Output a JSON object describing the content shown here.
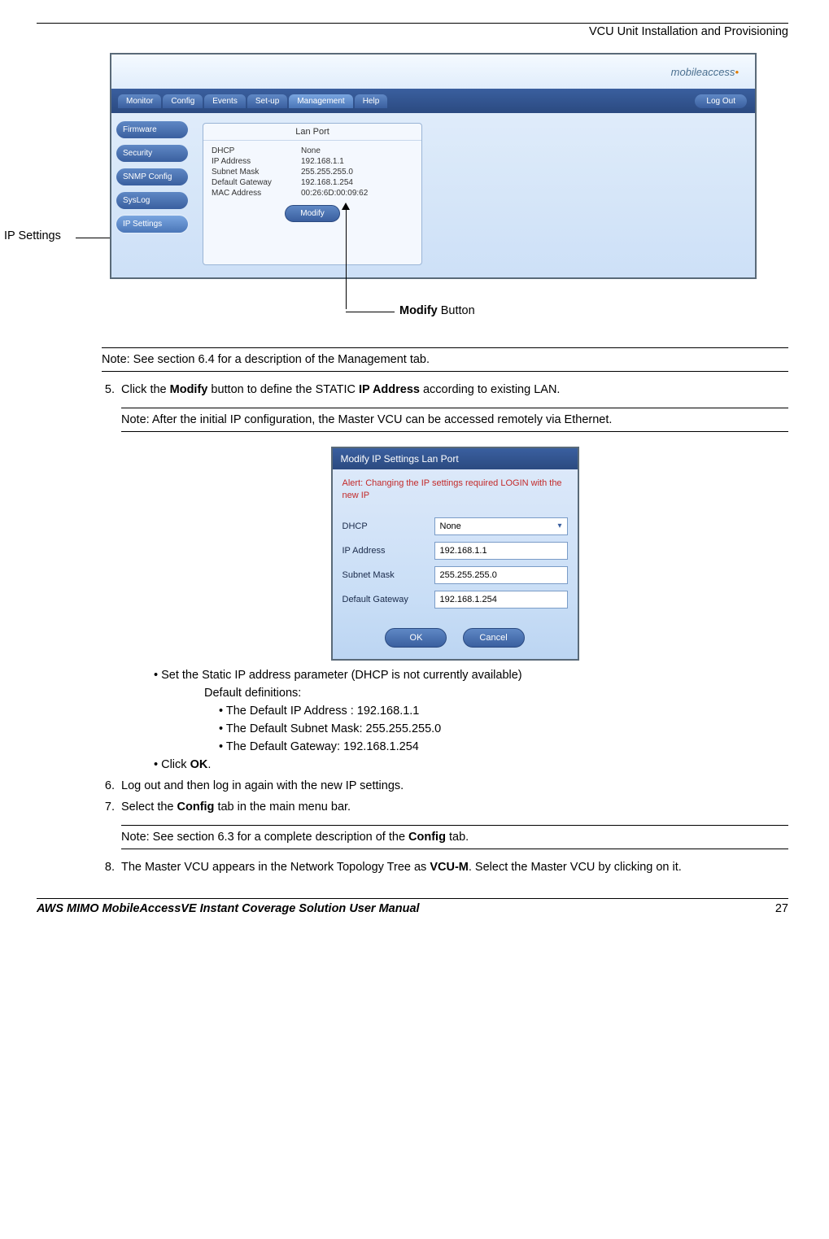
{
  "header": {
    "text": "VCU Unit Installation and Provisioning"
  },
  "fig1": {
    "brand": {
      "text": "mobileaccess",
      "dotchar": "•"
    },
    "menu": [
      {
        "label": "Monitor"
      },
      {
        "label": "Config"
      },
      {
        "label": "Events"
      },
      {
        "label": "Set-up"
      },
      {
        "label": "Management"
      },
      {
        "label": "Help"
      }
    ],
    "logout": "Log Out",
    "side": [
      {
        "label": "Firmware"
      },
      {
        "label": "Security"
      },
      {
        "label": "SNMP Config"
      },
      {
        "label": "SysLog"
      },
      {
        "label": "IP Settings"
      }
    ],
    "panel": {
      "title": "Lan Port",
      "rows": [
        {
          "k": "DHCP",
          "v": "None"
        },
        {
          "k": "IP Address",
          "v": "192.168.1.1"
        },
        {
          "k": "Subnet Mask",
          "v": "255.255.255.0"
        },
        {
          "k": "Default Gateway",
          "v": "192.168.1.254"
        },
        {
          "k": "MAC Address",
          "v": "00:26:6D:00:09:62"
        }
      ],
      "modify": "Modify"
    },
    "callouts": {
      "left": "IP Settings",
      "bottom_bold": "Modify",
      "bottom_rest": " Button"
    }
  },
  "note1": "Note: See section 6.4 for a description of the Management tab.",
  "step5": {
    "pre": "Click the ",
    "b1": "Modify",
    "mid": " button to define the STATIC ",
    "b2": "IP Address",
    "post": " according to existing LAN."
  },
  "note2": "Note: After the initial IP configuration, the Master VCU can be accessed remotely via Ethernet.",
  "dialog": {
    "title": "Modify IP Settings Lan Port",
    "alert": "Alert: Changing the IP settings required LOGIN with the new IP",
    "rows": {
      "dhcp_lbl": "DHCP",
      "dhcp_val": "None",
      "ip_lbl": "IP Address",
      "ip_val": "192.168.1.1",
      "mask_lbl": "Subnet Mask",
      "mask_val": "255.255.255.0",
      "gw_lbl": "Default Gateway",
      "gw_val": "192.168.1.254"
    },
    "ok": "OK",
    "cancel": "Cancel"
  },
  "bullets": {
    "b1": "Set the Static IP address parameter (DHCP is not currently available)",
    "defs_title": "Default definitions:",
    "d1": "The Default IP Address : 192.168.1.1",
    "d2": "The Default Subnet Mask: 255.255.255.0",
    "d3": "The Default Gateway: 192.168.1.254",
    "b2_pre": "Click ",
    "b2_b": "OK",
    "b2_post": "."
  },
  "step6": "Log out and then log in again with the new IP settings.",
  "step7": {
    "pre": "Select the ",
    "b": "Config",
    "post": " tab in the main menu bar."
  },
  "note3": {
    "pre": "Note: See section 6.3 for a complete description of the ",
    "b": "Config",
    "post": " tab."
  },
  "step8": {
    "pre": "The Master VCU appears in the Network Topology Tree as ",
    "b": "VCU-M",
    "post": ". Select the Master VCU by clicking on it."
  },
  "footer": {
    "left": "AWS MIMO MobileAccessVE Instant Coverage Solution User Manual",
    "right": "27"
  }
}
